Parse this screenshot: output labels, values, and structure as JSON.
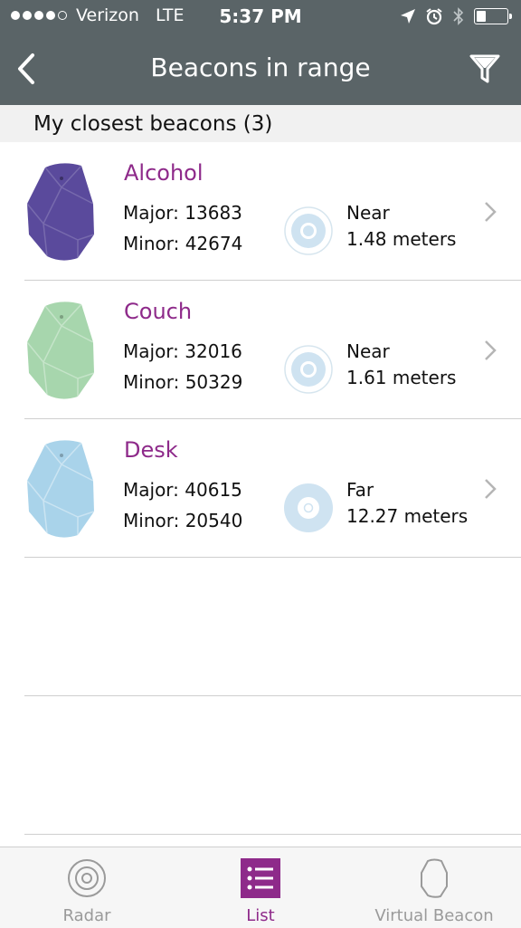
{
  "status_bar": {
    "carrier": "Verizon",
    "network": "LTE",
    "time": "5:37 PM",
    "signal_bars": 4,
    "signal_total": 5,
    "battery_level": 0.3,
    "icons": [
      "location-arrow-icon",
      "alarm-icon",
      "bluetooth-icon",
      "battery-icon"
    ]
  },
  "nav": {
    "title": "Beacons in range",
    "back_icon": "chevron-left-icon",
    "filter_icon": "filter-icon"
  },
  "section": {
    "title": "My closest beacons (3)"
  },
  "beacons": [
    {
      "name": "Alcohol",
      "major": "Major: 13683",
      "minor": "Minor: 42674",
      "proximity": "Near",
      "distance": "1.48 meters",
      "color": "#5a4a9c",
      "color_light": "#7a6ab8"
    },
    {
      "name": "Couch",
      "major": "Major: 32016",
      "minor": "Minor: 50329",
      "proximity": "Near",
      "distance": "1.61 meters",
      "color": "#a7d6ad",
      "color_light": "#cfe9d2"
    },
    {
      "name": "Desk",
      "major": "Major: 40615",
      "minor": "Minor: 20540",
      "proximity": "Far",
      "distance": "12.27 meters",
      "color": "#a9d3ea",
      "color_light": "#d3eaf6"
    }
  ],
  "tabs": [
    {
      "label": "Radar",
      "icon": "radar-icon",
      "active": false
    },
    {
      "label": "List",
      "icon": "list-icon",
      "active": true
    },
    {
      "label": "Virtual Beacon",
      "icon": "beacon-outline-icon",
      "active": false
    }
  ],
  "colors": {
    "bar": "#5a6467",
    "accent": "#8e2a8a",
    "proximity": "#c9e1f0"
  }
}
